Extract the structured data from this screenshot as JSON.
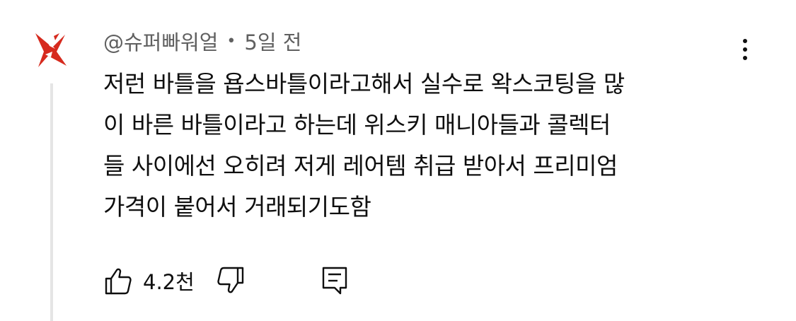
{
  "comment": {
    "author": "@슈퍼빠워얼",
    "separator": "•",
    "time": "5일 전",
    "text": "저런 바틀을 욥스바틀이라고해서 실수로 왁스코팅을 많\n이 바른 바틀이라고 하는데 위스키 매니아들과 콜렉터\n들 사이에선 오히려 저게 레어템 취급 받아서 프리미엄\n가격이 붙어서 거래되기도함",
    "like_count": "4.2천"
  },
  "icons": {
    "avatar": "red-star-logo",
    "more": "vertical-ellipsis-icon",
    "like": "thumbs-up-icon",
    "dislike": "thumbs-down-icon",
    "reply": "comment-reply-icon"
  },
  "colors": {
    "avatar_red": "#d62a1e",
    "meta_gray": "#606060",
    "text": "#0f0f0f"
  }
}
